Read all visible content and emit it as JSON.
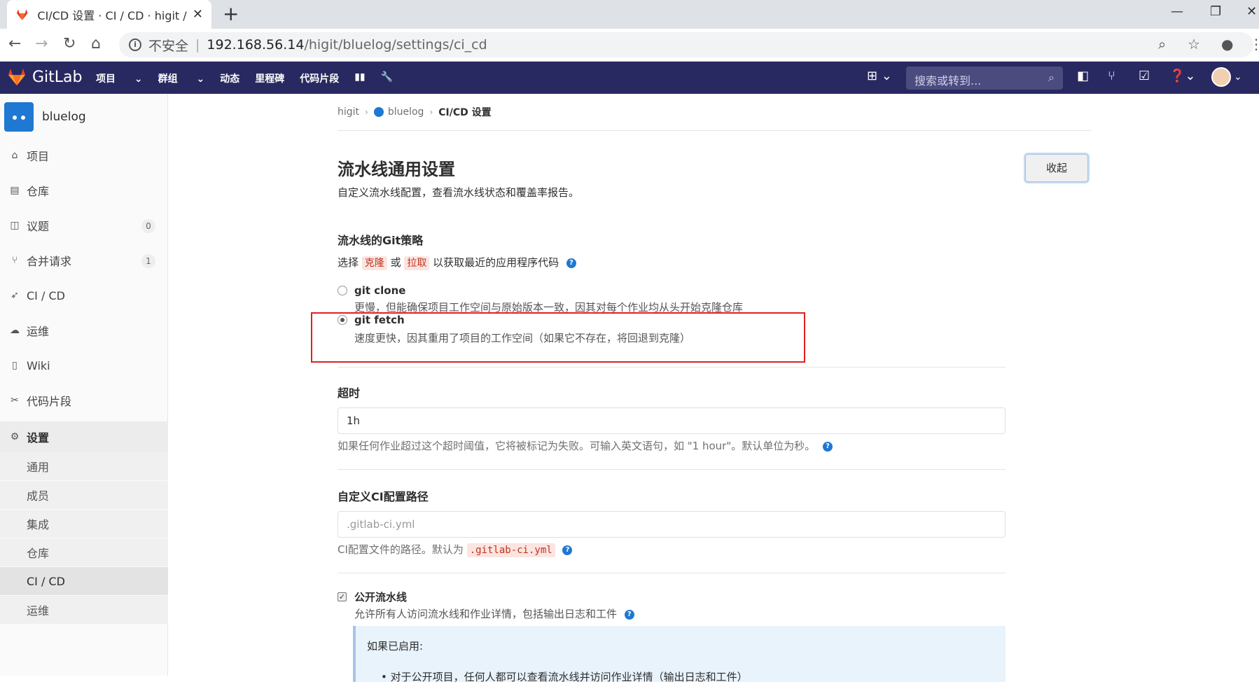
{
  "browser": {
    "tab_title": "CI/CD 设置 · CI / CD · higit / bluelog",
    "url_security": "不安全",
    "url_host": "192.168.56.14",
    "url_path": "/higit/bluelog/settings/ci_cd"
  },
  "navbar": {
    "brand": "GitLab",
    "menu": [
      "项目",
      "群组",
      "动态",
      "里程碑",
      "代码片段"
    ],
    "search_placeholder": "搜索或转到..."
  },
  "sidebar": {
    "project_name": "bluelog",
    "items": [
      {
        "label": "项目",
        "icon": "home-icon"
      },
      {
        "label": "仓库",
        "icon": "doc-icon"
      },
      {
        "label": "议题",
        "icon": "issues-icon",
        "badge": "0"
      },
      {
        "label": "合并请求",
        "icon": "merge-request-icon",
        "badge": "1"
      },
      {
        "label": "CI / CD",
        "icon": "rocket-icon"
      },
      {
        "label": "运维",
        "icon": "cloud-gear-icon"
      },
      {
        "label": "Wiki",
        "icon": "book-icon"
      },
      {
        "label": "代码片段",
        "icon": "scissors-icon"
      },
      {
        "label": "设置",
        "icon": "gear-icon"
      }
    ],
    "settings_sub": [
      "通用",
      "成员",
      "集成",
      "仓库",
      "CI / CD",
      "运维"
    ]
  },
  "breadcrumb": {
    "group": "higit",
    "project": "bluelog",
    "current": "CI/CD 设置"
  },
  "section": {
    "title": "流水线通用设置",
    "subtitle": "自定义流水线配置，查看流水线状态和覆盖率报告。",
    "collapse_label": "收起"
  },
  "git_strategy": {
    "label": "流水线的Git策略",
    "desc_prefix": "选择",
    "clone_word": "克隆",
    "or_word": "或",
    "fetch_word": "拉取",
    "desc_suffix": "以获取最近的应用程序代码",
    "options": [
      {
        "label": "git clone",
        "desc": "更慢，但能确保项目工作空间与原始版本一致，因其对每个作业均从头开始克隆仓库",
        "selected": false
      },
      {
        "label": "git fetch",
        "desc": "速度更快，因其重用了项目的工作空间（如果它不存在，将回退到克隆）",
        "selected": true
      }
    ]
  },
  "timeout": {
    "label": "超时",
    "value": "1h",
    "hint": "如果任何作业超过这个超时阈值，它将被标记为失败。可输入英文语句，如 \"1 hour\"。默认单位为秒。"
  },
  "ci_path": {
    "label": "自定义CI配置路径",
    "placeholder": ".gitlab-ci.yml",
    "hint_prefix": "CI配置文件的路径。默认为",
    "hint_code": ".gitlab-ci.yml"
  },
  "public_pipelines": {
    "label": "公开流水线",
    "checked": true,
    "desc": "允许所有人访问流水线和作业详情，包括输出日志和工件",
    "info_title": "如果已启用:",
    "info_item": "对于公开项目，任何人都可以查看流水线并访问作业详情（输出日志和工件）"
  },
  "colors": {
    "navbar_bg": "#292961",
    "accent": "#1f78d1",
    "highlight_box": "#e02020"
  }
}
